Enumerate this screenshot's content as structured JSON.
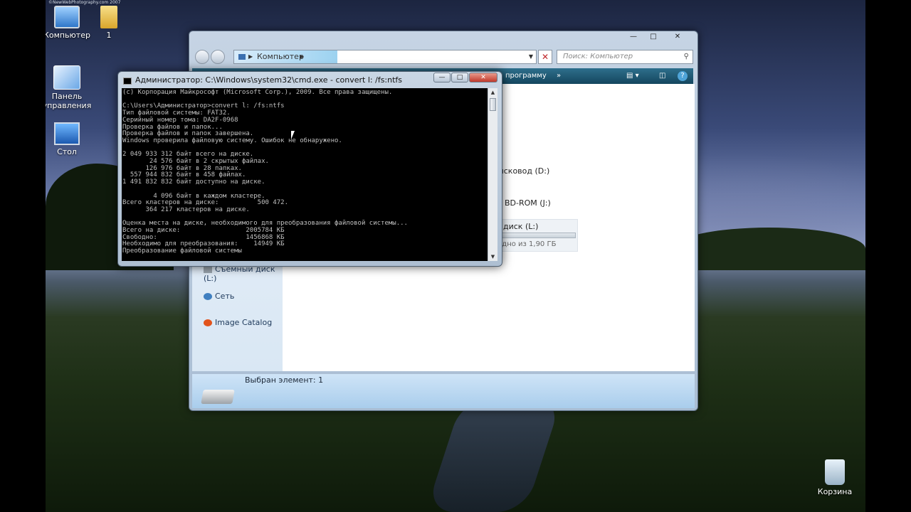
{
  "watermark": "©NewWebPhotography.com 2007",
  "desktop": {
    "icons": [
      {
        "label": "Компьютер"
      },
      {
        "label": "1"
      },
      {
        "label": "Панель управления"
      },
      {
        "label": "Стол"
      },
      {
        "label": "Корзина"
      }
    ]
  },
  "explorer": {
    "address": "Компьютер",
    "search_placeholder": "Поиск: Компьютер",
    "toolbar": {
      "text": "программу",
      "more": "»"
    },
    "nav": {
      "removable": "Съемный диск (L:)",
      "network": "Сеть",
      "image_catalog": "Image Catalog"
    },
    "drives": {
      "d": "дисковод (D:)",
      "j": "BD-ROM (J:)",
      "l": "диск (L:)",
      "l_free": "бодно из 1,90 ГБ",
      "l_used_fraction": 0.0
    },
    "details": {
      "selected": "Выбран элемент: 1"
    }
  },
  "cmd": {
    "title": "Администратор: C:\\Windows\\system32\\cmd.exe - convert  l: /fs:ntfs",
    "output": "(c) Корпорация Майкрософт (Microsoft Corp.), 2009. Все права защищены.\n\nC:\\Users\\Администратор>convert l: /fs:ntfs\nТип файловой системы: FAT32.\nСерийный номер тома: DA2F-0968\nПроверка файлов и папок...\nПроверка файлов и папок завершена.\nWindows проверила файловую систему. Ошибок не обнаружено.\n\n2 049 933 312 байт всего на диске.\n       24 576 байт в 2 скрытых файлах.\n      126 976 байт в 28 папках.\n  557 944 832 байт в 458 файлах.\n1 491 832 832 байт доступно на диске.\n\n        4 096 байт в каждом кластере.\nВсего кластеров на диске:          500 472.\n      364 217 кластеров на диске.\n\nОценка места на диске, необходимого для преобразования файловой системы...\nВсего на диске:                 2005784 КБ\nСвободно:                       1456868 КБ\nНеобходимо для преобразования:    14949 КБ\nПреобразование файловой системы"
  }
}
